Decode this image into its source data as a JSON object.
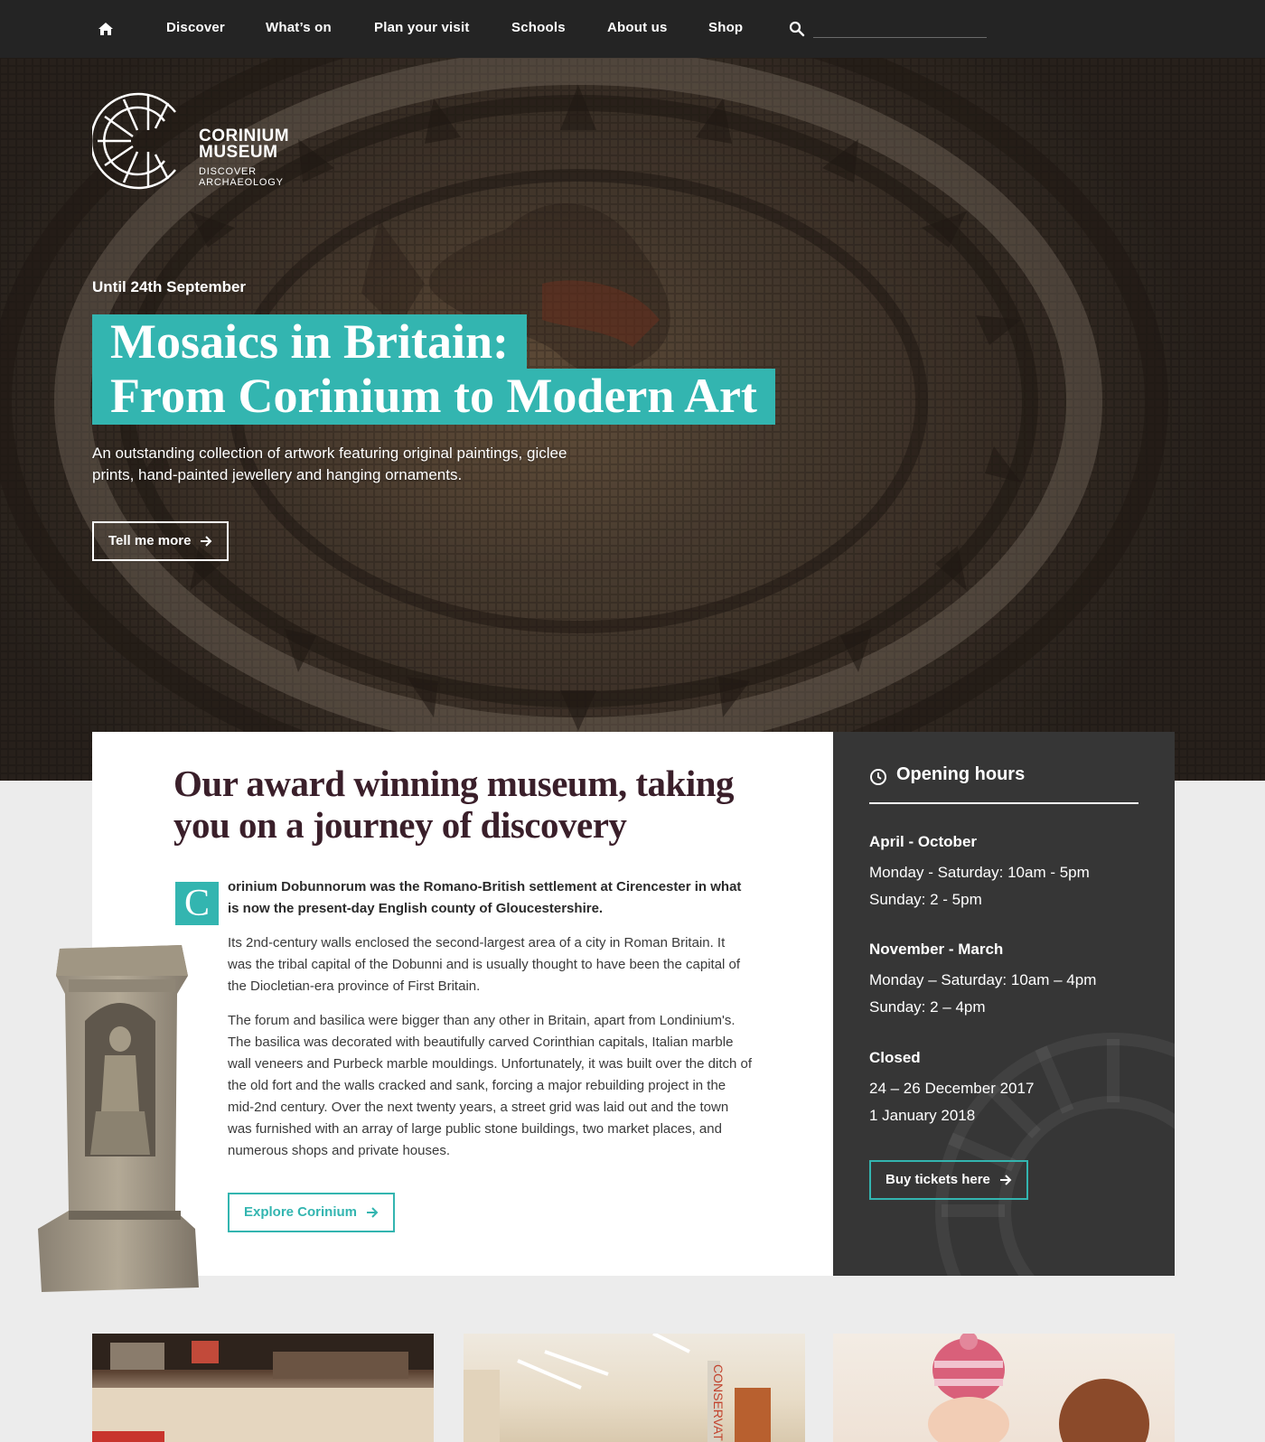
{
  "nav": {
    "items": [
      "Discover",
      "What’s on",
      "Plan your visit",
      "Schools",
      "About us",
      "Shop"
    ],
    "search_placeholder": ""
  },
  "hero": {
    "logo_line1": "CORINIUM",
    "logo_line2": "MUSEUM",
    "logo_tag1": "DISCOVER",
    "logo_tag2": "ARCHAEOLOGY",
    "date": "Until 24th September",
    "title_line1": "Mosaics in Britain:",
    "title_line2": "From Corinium to Modern Art",
    "lead": "An outstanding collection of artwork featuring original paintings, giclee prints, hand-painted jewellery and hanging ornaments.",
    "cta_label": "Tell me more"
  },
  "content": {
    "heading": "Our award winning museum, taking you on a journey of discovery",
    "dropcap": "C",
    "intro": "orinium Dobunnorum was the Romano-British settlement at Cirencester in what is now the present-day English county of Gloucestershire.",
    "para1": "Its 2nd-century walls enclosed the second-largest area of a city in Roman Britain. It was the tribal capital of the Dobunni and is usually thought to have been the capital of the Diocletian-era province of First Britain.",
    "para2": "The forum and basilica were bigger than any other in Britain, apart from Londinium's. The basilica was decorated with beautifully carved Corinthian capitals, Italian marble wall veneers and Purbeck marble mouldings. Unfortunately, it was built over the ditch of the old fort and the walls cracked and sank, forcing a major rebuilding project in the mid-2nd century.  Over the next twenty years, a street grid was laid out and the town was furnished with an array of large public stone buildings, two market places, and numerous shops and private houses.",
    "explore_label": "Explore Corinium"
  },
  "hours": {
    "title": "Opening hours",
    "season1": "April - October",
    "season1_lines": [
      "Monday - Saturday: 10am - 5pm",
      "Sunday: 2 - 5pm"
    ],
    "season2": "November - March",
    "season2_lines": [
      "Monday – Saturday: 10am – 4pm",
      "Sunday: 2 – 4pm"
    ],
    "closed": "Closed",
    "closed_lines": [
      "24 – 26 December 2017",
      "1 January 2018"
    ],
    "buy_label": "Buy tickets here"
  },
  "colors": {
    "accent": "#33b5b0",
    "nav_bg": "#242424",
    "hours_bg": "#363636",
    "heading": "#3a1f2a"
  },
  "icons": [
    "home-icon",
    "search-icon",
    "arrow-right-icon",
    "clock-icon"
  ]
}
